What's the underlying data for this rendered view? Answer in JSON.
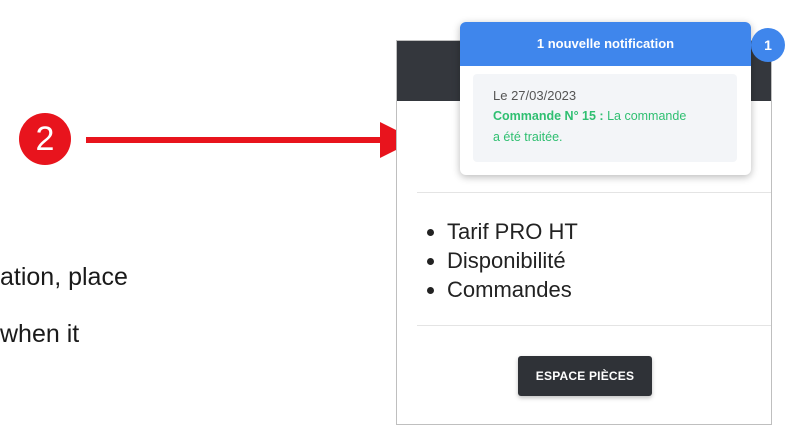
{
  "background_text": {
    "line1": "ation, place",
    "line2": "when it"
  },
  "annotation": {
    "step_number": "2",
    "color": "#e8141d"
  },
  "notification": {
    "title": "1 nouvelle notification",
    "count": "1",
    "date": "Le 27/03/2023",
    "order_label": "Commande N° 15 :",
    "message": "La commande a été traitée."
  },
  "card": {
    "features": [
      "Tarif PRO HT",
      "Disponibilité",
      "Commandes"
    ],
    "button_label": "ESPACE PIÈCES"
  },
  "colors": {
    "notification_header": "#3f86ec",
    "success_text": "#2fbf71",
    "card_header": "#34373d",
    "button": "#2f3237"
  }
}
